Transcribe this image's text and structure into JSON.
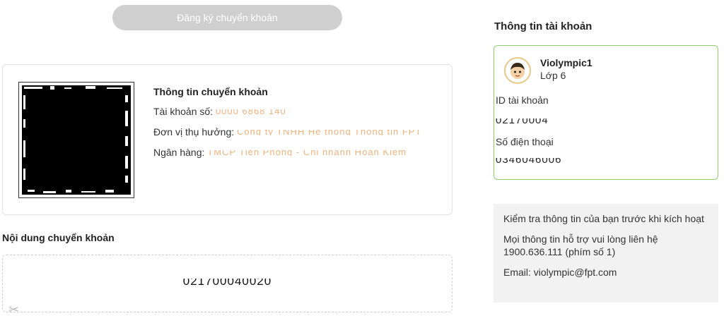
{
  "register_button": {
    "label": "Đăng ký chuyển khoản"
  },
  "transfer_info": {
    "title": "Thông tin chuyển khoản",
    "account_number_label": "Tài khoản số:",
    "account_number_value": "0000 6868 140",
    "beneficiary_label": "Đơn vị thụ hưởng:",
    "beneficiary_value": "Công ty TNHH Hệ thống Thông tin FPT",
    "bank_label": "Ngân hàng:",
    "bank_value": "TMCP Tiên Phong - Chi nhánh Hoàn Kiếm"
  },
  "transfer_content": {
    "label": "Nội dung chuyển khoản",
    "code": "021700040020"
  },
  "account": {
    "heading": "Thông tin tài khoản",
    "username": "Violympic1",
    "grade": "Lớp 6",
    "id_label": "ID tài khoản",
    "id_value": "02170004",
    "phone_label": "Số điện thoại",
    "phone_value": "0346046006"
  },
  "help": {
    "line1": "Kiểm tra thông tin của bạn trước khi kích hoạt",
    "line2": "Mọi thông tin hỗ trợ vui lòng liên hệ 1900.636.111 (phím số 1)",
    "line3": "Email: violympic@fpt.com"
  },
  "icons": {
    "scissors": "scissors-icon",
    "avatar": "avatar-icon",
    "qr": "qr-code"
  },
  "colors": {
    "card_border_active": "#8fcf6a",
    "button_disabled": "#cfcfcf",
    "masked_text": "#f2b27a"
  }
}
